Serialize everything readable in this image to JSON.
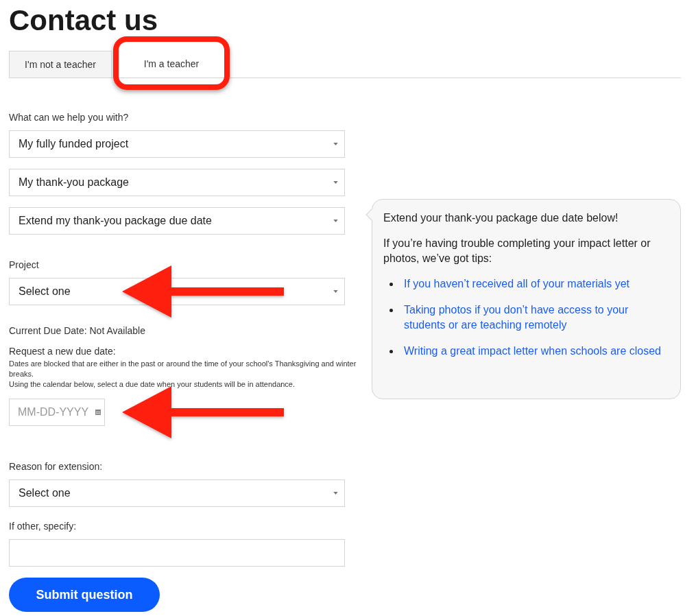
{
  "title": "Contact us",
  "tabs": [
    {
      "label": "I'm not a teacher",
      "selected": false
    },
    {
      "label": "I'm a teacher",
      "selected": true
    }
  ],
  "help": {
    "label": "What can we help you with?",
    "selects": [
      "My fully funded project",
      "My thank-you package",
      "Extend my thank-you package due date"
    ]
  },
  "project": {
    "label": "Project",
    "value": "Select one"
  },
  "current_due_date": "Current Due Date: Not Available",
  "request_label": "Request a new due date:",
  "notes": [
    "Dates are blocked that are either in the past or around the time of your school's Thanksgiving and winter breaks.",
    "Using the calendar below, select a due date when your students will be in attendance."
  ],
  "date_field": {
    "placeholder": "MM-DD-YYYY"
  },
  "reason": {
    "label": "Reason for extension:",
    "value": "Select one"
  },
  "other": {
    "label": "If other, specify:"
  },
  "submit": "Submit question",
  "tip": {
    "heading": "Extend your thank-you package due date below!",
    "intro": "If you’re having trouble completing your impact letter or photos, we’ve got tips:",
    "links": [
      "If you haven’t received all of your materials yet",
      "Taking photos if you don’t have access to your students or are teaching remotely",
      "Writing a great impact letter when schools are closed"
    ]
  },
  "annotations": [
    {
      "kind": "highlight"
    },
    {
      "kind": "arrow"
    },
    {
      "kind": "arrow"
    }
  ]
}
